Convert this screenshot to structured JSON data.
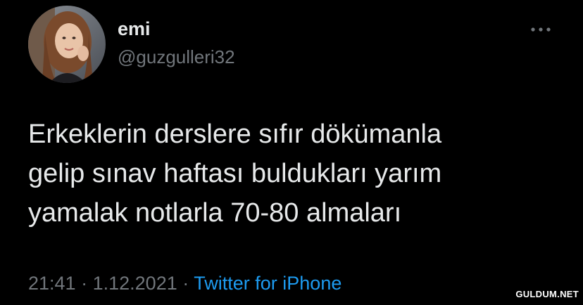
{
  "tweet": {
    "display_name": "emi",
    "handle": "@guzgulleri32",
    "text_lines": [
      "Erkeklerin derslere sıfır dökümanla",
      "gelip sınav haftası buldukları yarım",
      "yamalak notlarla 70-80 almaları"
    ],
    "time": "21:41",
    "separator": "·",
    "date": "1.12.2021",
    "source": "Twitter for iPhone",
    "more_icon": "more-horizontal-icon"
  },
  "watermark": {
    "text": "GULDUM.NET"
  },
  "colors": {
    "background": "#000000",
    "primary_text": "#e7e9ea",
    "secondary_text": "#71767b",
    "link": "#1d9bf0"
  }
}
